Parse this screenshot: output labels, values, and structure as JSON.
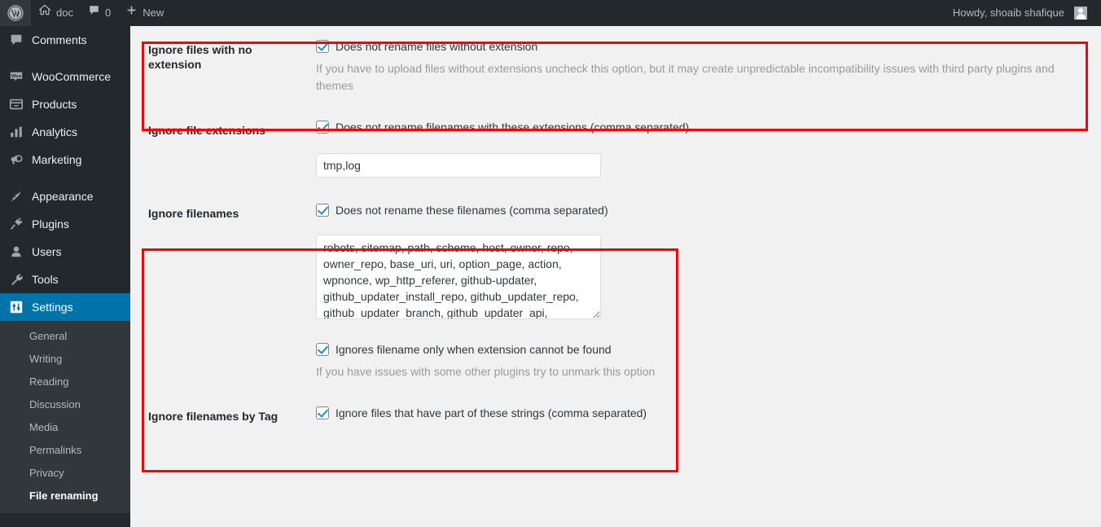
{
  "adminbar": {
    "logo_icon": "wordpress-logo",
    "site_icon": "home-icon",
    "site_name": "doc",
    "comments_icon": "comment-bubble-icon",
    "comments_count": "0",
    "new_icon": "plus-icon",
    "new_label": "New",
    "howdy": "Howdy, shoaib shafique",
    "avatar_icon": "user-avatar"
  },
  "sidebar": {
    "items": [
      {
        "label": "Comments",
        "icon": "comment-bubble-icon",
        "name": "comments"
      },
      {
        "label": "WooCommerce",
        "icon": "woocommerce-icon",
        "name": "woocommerce"
      },
      {
        "label": "Products",
        "icon": "products-icon",
        "name": "products"
      },
      {
        "label": "Analytics",
        "icon": "analytics-bars-icon",
        "name": "analytics"
      },
      {
        "label": "Marketing",
        "icon": "megaphone-icon",
        "name": "marketing"
      },
      {
        "label": "Appearance",
        "icon": "paintbrush-icon",
        "name": "appearance"
      },
      {
        "label": "Plugins",
        "icon": "plug-icon",
        "name": "plugins"
      },
      {
        "label": "Users",
        "icon": "user-icon",
        "name": "users"
      },
      {
        "label": "Tools",
        "icon": "wrench-icon",
        "name": "tools"
      },
      {
        "label": "Settings",
        "icon": "sliders-icon",
        "name": "settings"
      }
    ],
    "active_item": "Settings",
    "submenu": [
      {
        "label": "General",
        "current": false
      },
      {
        "label": "Writing",
        "current": false
      },
      {
        "label": "Reading",
        "current": false
      },
      {
        "label": "Discussion",
        "current": false
      },
      {
        "label": "Media",
        "current": false
      },
      {
        "label": "Permalinks",
        "current": false
      },
      {
        "label": "Privacy",
        "current": false
      },
      {
        "label": "File renaming",
        "current": true
      }
    ]
  },
  "settings": {
    "rows": [
      {
        "title": "Ignore files with no extension",
        "checkbox_label": "Does not rename files without extension",
        "checked": true,
        "description": "If you have to upload files without extensions uncheck this option, but it may create unpredictable incompatibility issues with third party plugins and themes"
      },
      {
        "title": "Ignore file extensions",
        "checkbox_label": "Does not rename filenames with these extensions (comma separated)",
        "checked": true,
        "input_value": "tmp,log"
      },
      {
        "title": "Ignore filenames",
        "checkbox_label": "Does not rename these filenames (comma separated)",
        "checked": true,
        "textarea_value": "robots, sitemap, path, scheme, host, owner, repo, owner_repo, base_uri, uri, option_page, action, wpnonce, wp_http_referer, github-updater, github_updater_install_repo, github_updater_repo, github_updater_branch, github_updater_api,",
        "sub_checkbox_label": "Ignores filename only when extension cannot be found",
        "sub_checked": true,
        "sub_description": "If you have issues with some other plugins try to unmark this option"
      },
      {
        "title": "Ignore filenames by Tag",
        "checkbox_label": "Ignore files that have part of these strings (comma separated)",
        "checked": true
      }
    ]
  },
  "highlights": {
    "color": "#ff0000",
    "boxes": [
      "ignore-files-with-no-extension",
      "ignore-filenames"
    ]
  }
}
